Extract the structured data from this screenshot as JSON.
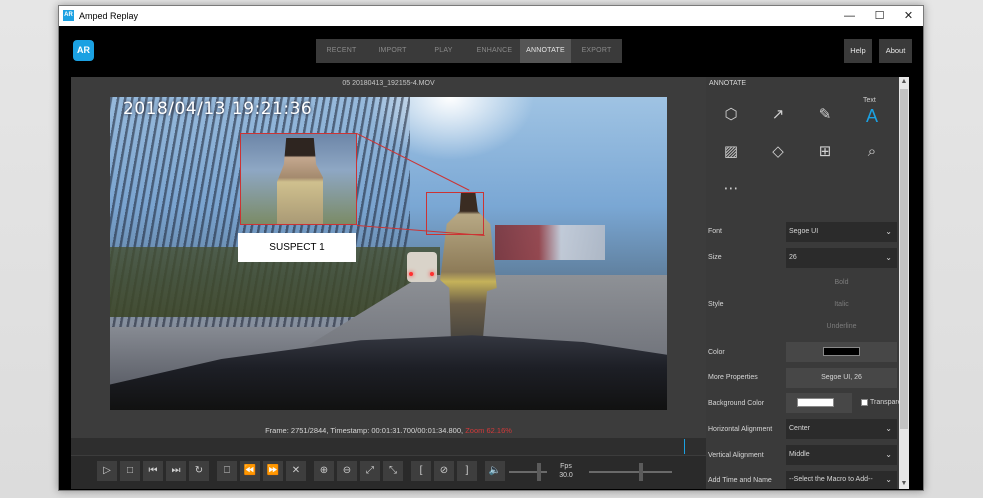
{
  "window": {
    "title": "Amped Replay",
    "icon_text": "AR",
    "controls": {
      "minimize": "—",
      "maximize": "☐",
      "close": "✕"
    }
  },
  "appbar": {
    "logo_text": "AR",
    "tabs": [
      {
        "label": "RECENT",
        "active": false
      },
      {
        "label": "IMPORT",
        "active": false
      },
      {
        "label": "PLAY",
        "active": false
      },
      {
        "label": "ENHANCE",
        "active": false
      },
      {
        "label": "ANNOTATE",
        "active": true
      },
      {
        "label": "EXPORT",
        "active": false
      }
    ],
    "help_label": "Help",
    "about_label": "About"
  },
  "viewer": {
    "filename": "05 20180413_192155-4.MOV",
    "video_timestamp": "2018/04/13   19:21:36",
    "annotation_text": "SUSPECT 1",
    "frame_info": "Frame: 2751/2844, Timestamp: 00:01:31.700/00:01:34.800,",
    "frame_warning": "Zoom 62.16%",
    "fps_label": "Fps",
    "fps_value": "30.0",
    "playback_controls": [
      {
        "icon": "play-icon",
        "glyph": "▷"
      },
      {
        "icon": "stop-icon",
        "glyph": "□"
      },
      {
        "icon": "previous-frame-icon",
        "glyph": "⏮"
      },
      {
        "icon": "next-frame-icon",
        "glyph": "⏭"
      },
      {
        "icon": "loop-icon",
        "glyph": "↻"
      },
      {
        "icon": "bookmark-icon",
        "glyph": "⎕"
      },
      {
        "icon": "rewind-icon",
        "glyph": "⏪"
      },
      {
        "icon": "fast-forward-icon",
        "glyph": "⏩"
      },
      {
        "icon": "close-icon",
        "glyph": "✕"
      },
      {
        "icon": "zoom-in-icon",
        "glyph": "⊕"
      },
      {
        "icon": "zoom-out-icon",
        "glyph": "⊖"
      },
      {
        "icon": "fit-icon",
        "glyph": "⤢"
      },
      {
        "icon": "shrink-icon",
        "glyph": "⤡"
      },
      {
        "icon": "mark-in-icon",
        "glyph": "["
      },
      {
        "icon": "clear-range-icon",
        "glyph": "⊘"
      },
      {
        "icon": "mark-out-icon",
        "glyph": "]"
      },
      {
        "icon": "volume-icon",
        "glyph": "🔈"
      }
    ]
  },
  "panel": {
    "title": "ANNOTATE",
    "active_tool_caption": "Text",
    "tools": [
      {
        "icon": "shape-icon",
        "glyph": "⬡"
      },
      {
        "icon": "arrow-icon",
        "glyph": "↗"
      },
      {
        "icon": "pencil-icon",
        "glyph": "✎"
      },
      {
        "icon": "text-icon",
        "glyph": "A"
      },
      {
        "icon": "image-icon",
        "glyph": "▨"
      },
      {
        "icon": "blur-drop-icon",
        "glyph": "◇"
      },
      {
        "icon": "magnify-icon",
        "glyph": "⊞"
      },
      {
        "icon": "spotlight-icon",
        "glyph": "⌕"
      },
      {
        "icon": "more-icon",
        "glyph": "⋯"
      }
    ],
    "font_label": "Font",
    "font_value": "Segoe UI",
    "size_label": "Size",
    "size_value": "26",
    "style_label": "Style",
    "style_bold": "Bold",
    "style_italic": "Italic",
    "style_underline": "Underline",
    "color_label": "Color",
    "text_color": "#000000",
    "more_props_label": "More Properties",
    "more_props_value": "Segoe UI, 26",
    "bg_color_label": "Background Color",
    "bg_color": "#ffffff",
    "transparent_label": "Transparent",
    "halign_label": "Horizontal Alignment",
    "halign_value": "Center",
    "valign_label": "Vertical Alignment",
    "valign_value": "Middle",
    "time_name_label": "Add Time and Name",
    "time_name_value": "--Select the Macro to Add--"
  },
  "colors": {
    "accent": "#1ba1e2",
    "annotation_red": "#cc3333",
    "warning_red": "#d23a3a"
  }
}
